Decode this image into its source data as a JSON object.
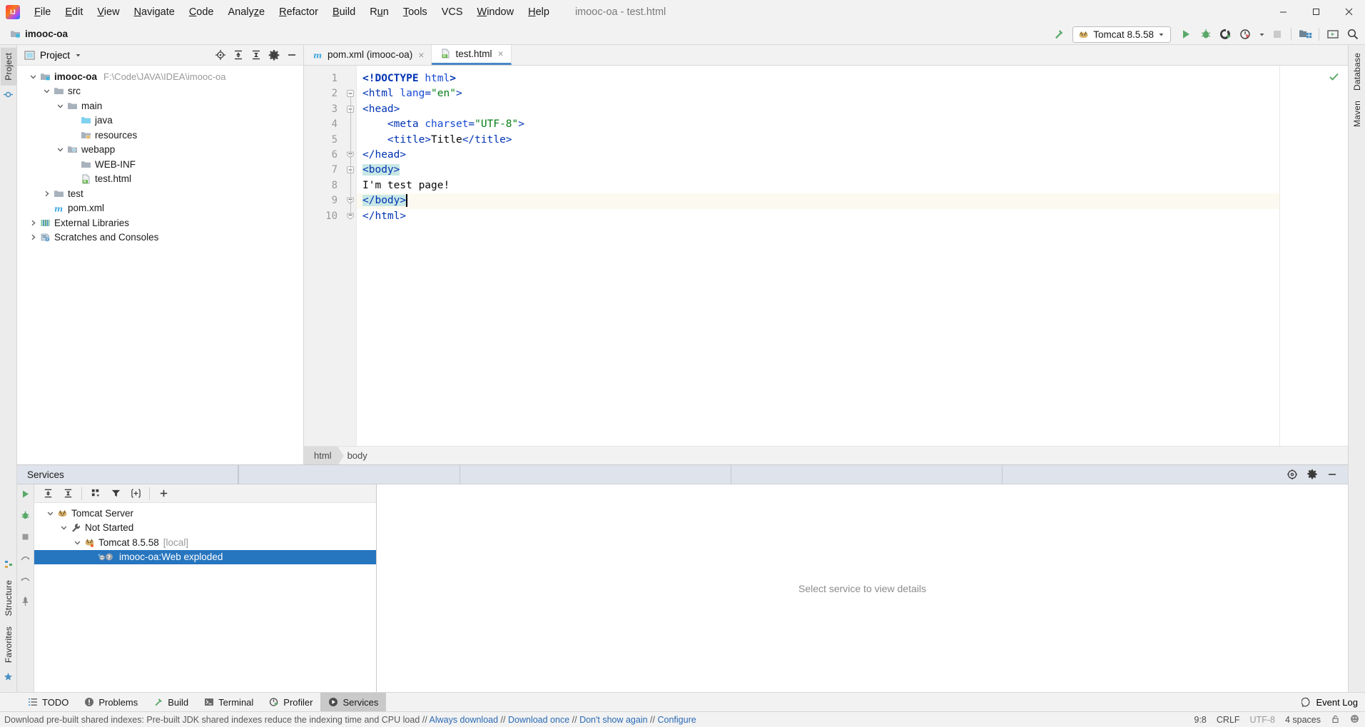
{
  "window": {
    "title": "imooc-oa - test.html",
    "project_name": "imooc-oa"
  },
  "menu": {
    "items": [
      {
        "pre": "",
        "mn": "F",
        "post": "ile"
      },
      {
        "pre": "",
        "mn": "E",
        "post": "dit"
      },
      {
        "pre": "",
        "mn": "V",
        "post": "iew"
      },
      {
        "pre": "",
        "mn": "N",
        "post": "avigate"
      },
      {
        "pre": "",
        "mn": "C",
        "post": "ode"
      },
      {
        "pre": "Analy",
        "mn": "z",
        "post": "e"
      },
      {
        "pre": "",
        "mn": "R",
        "post": "efactor"
      },
      {
        "pre": "",
        "mn": "B",
        "post": "uild"
      },
      {
        "pre": "R",
        "mn": "u",
        "post": "n"
      },
      {
        "pre": "",
        "mn": "T",
        "post": "ools"
      },
      {
        "pre": "VCS",
        "mn": "",
        "post": ""
      },
      {
        "pre": "",
        "mn": "W",
        "post": "indow"
      },
      {
        "pre": "",
        "mn": "H",
        "post": "elp"
      }
    ]
  },
  "toolbar": {
    "run_config": "Tomcat 8.5.58",
    "icons": [
      "build-hammer-icon",
      "run-icon",
      "debug-icon",
      "run-coverage-icon",
      "profiler-icon",
      "stop-icon",
      "project-structure-icon",
      "update-icon",
      "search-everywhere-icon"
    ]
  },
  "left_rail": {
    "top_tabs": [
      "Project"
    ],
    "bottom_tabs": [
      "Structure",
      "Favorites"
    ]
  },
  "right_rail": {
    "tabs": [
      "Database",
      "Maven"
    ]
  },
  "project_panel": {
    "title": "Project",
    "actions": [
      "locate-icon",
      "expand-all-icon",
      "collapse-all-icon",
      "settings-gear-icon",
      "hide-icon"
    ],
    "tree": [
      {
        "depth": 0,
        "arrow": "down",
        "icon": "module-folder-icon",
        "label": "imooc-oa",
        "bold": true,
        "path": "F:\\Code\\JAVA\\IDEA\\imooc-oa"
      },
      {
        "depth": 1,
        "arrow": "down",
        "icon": "folder-icon",
        "label": "src",
        "bold": false,
        "path": ""
      },
      {
        "depth": 2,
        "arrow": "down",
        "icon": "folder-icon",
        "label": "main",
        "bold": false,
        "path": ""
      },
      {
        "depth": 3,
        "arrow": "none",
        "icon": "source-folder-icon",
        "label": "java",
        "bold": false,
        "path": ""
      },
      {
        "depth": 3,
        "arrow": "none",
        "icon": "resources-folder-icon",
        "label": "resources",
        "bold": false,
        "path": ""
      },
      {
        "depth": 2,
        "arrow": "down",
        "icon": "webapp-folder-icon",
        "label": "webapp",
        "bold": false,
        "path": ""
      },
      {
        "depth": 3,
        "arrow": "none",
        "icon": "folder-icon",
        "label": "WEB-INF",
        "bold": false,
        "path": ""
      },
      {
        "depth": 3,
        "arrow": "none",
        "icon": "html-file-icon",
        "label": "test.html",
        "bold": false,
        "path": ""
      },
      {
        "depth": 1,
        "arrow": "right",
        "icon": "folder-icon",
        "label": "test",
        "bold": false,
        "path": ""
      },
      {
        "depth": 1,
        "arrow": "none",
        "icon": "maven-pom-icon",
        "label": "pom.xml",
        "bold": false,
        "path": ""
      },
      {
        "depth": 0,
        "arrow": "right",
        "icon": "library-icon",
        "label": "External Libraries",
        "bold": false,
        "path": ""
      },
      {
        "depth": 0,
        "arrow": "right",
        "icon": "scratches-icon",
        "label": "Scratches and Consoles",
        "bold": false,
        "path": ""
      }
    ]
  },
  "editor": {
    "tabs": [
      {
        "label": "pom.xml (imooc-oa)",
        "icon": "maven-pom-icon",
        "active": false
      },
      {
        "label": "test.html",
        "icon": "html-file-icon",
        "active": true
      }
    ],
    "line_numbers": [
      "1",
      "2",
      "3",
      "4",
      "5",
      "6",
      "7",
      "8",
      "9",
      "10"
    ],
    "caret_line": 9,
    "breadcrumbs": [
      {
        "label": "html",
        "selected": true
      },
      {
        "label": "body",
        "selected": false
      }
    ],
    "code_lines": [
      {
        "n": 1,
        "html": "<span class='tok-doctype'>&lt;!DOCTYPE</span> <span class='tok-dtval'>html</span><span class='tok-doctype'>&gt;</span>"
      },
      {
        "n": 2,
        "html": "<span class='tok-tag'>&lt;html</span> <span class='tok-attr'>lang</span><span class='tok-tag'>=</span><span class='tok-str'>\"en\"</span><span class='tok-tag'>&gt;</span>"
      },
      {
        "n": 3,
        "html": "<span class='tok-tag'>&lt;head&gt;</span>"
      },
      {
        "n": 4,
        "html": "    <span class='tok-tag'>&lt;meta</span> <span class='tok-attr'>charset</span><span class='tok-tag'>=</span><span class='tok-str'>\"UTF-8\"</span><span class='tok-tag'>&gt;</span>"
      },
      {
        "n": 5,
        "html": "    <span class='tok-tag'>&lt;title&gt;</span><span class='tok-txt'>Title</span><span class='tok-tag'>&lt;/title&gt;</span>"
      },
      {
        "n": 6,
        "html": "<span class='tok-tag'>&lt;/head&gt;</span>"
      },
      {
        "n": 7,
        "html": "<span class='tok-tag hl-brace'>&lt;body&gt;</span>"
      },
      {
        "n": 8,
        "html": "<span class='tok-txt'>I'm test page!</span>"
      },
      {
        "n": 9,
        "html": "<span class='tok-tag hl-brace'>&lt;/body&gt;</span>"
      },
      {
        "n": 10,
        "html": "<span class='tok-tag'>&lt;/html&gt;</span>"
      }
    ],
    "code_plain": [
      "<!DOCTYPE html>",
      "<html lang=\"en\">",
      "<head>",
      "    <meta charset=\"UTF-8\">",
      "    <title>Title</title>",
      "</head>",
      "<body>",
      "I'm test page!",
      "</body>",
      "</html>"
    ]
  },
  "services": {
    "header_title": "Services",
    "header_actions": [
      "settings-view-icon",
      "gear-icon",
      "hide-icon"
    ],
    "toolbar_icons": [
      "expand-all-icon",
      "collapse-all-icon",
      "group-icon",
      "filter-icon",
      "new-tab-icon",
      "add-icon"
    ],
    "rail_icons": [
      "run-icon",
      "debug-icon",
      "stop-icon",
      "step-over-icon",
      "step-back-icon",
      "pin-icon"
    ],
    "tree": [
      {
        "depth": 0,
        "arrow": "down",
        "icon": "tomcat-icon",
        "label": "Tomcat Server",
        "suffix": "",
        "selected": false
      },
      {
        "depth": 1,
        "arrow": "down",
        "icon": "wrench-icon",
        "label": "Not Started",
        "suffix": "",
        "selected": false
      },
      {
        "depth": 2,
        "arrow": "down",
        "icon": "tomcat-icon",
        "label": "Tomcat 8.5.58",
        "suffix": "[local]",
        "selected": false
      },
      {
        "depth": 3,
        "arrow": "none",
        "icon": "web-artifact-icon",
        "label": "imooc-oa:Web exploded",
        "suffix": "",
        "selected": true
      }
    ],
    "detail_placeholder": "Select service to view details"
  },
  "toolwindow_bar": {
    "items": [
      {
        "label": "TODO",
        "icon": "todo-icon",
        "active": false
      },
      {
        "label": "Problems",
        "icon": "problems-icon",
        "active": false
      },
      {
        "label": "Build",
        "icon": "build-icon",
        "active": false
      },
      {
        "label": "Terminal",
        "icon": "terminal-icon",
        "active": false
      },
      {
        "label": "Profiler",
        "icon": "profiler-icon",
        "active": false
      },
      {
        "label": "Services",
        "icon": "services-icon",
        "active": true
      }
    ],
    "event_log": "Event Log"
  },
  "statusbar": {
    "message_prefix": "Download pre-built shared indexes: Pre-built JDK shared indexes reduce the indexing time and CPU load // ",
    "link1": "Always download",
    "sep1": " // ",
    "link2": "Download once",
    "sep2": " // ",
    "link3": "Don't show again",
    "sep3": " // ",
    "link4": "Configure",
    "caret_position": "9:8",
    "line_separator": "CRLF",
    "encoding": "UTF-8",
    "indent": "4 spaces",
    "lock_icon": "lock-icon",
    "inspection_icon": "inspection-icon"
  },
  "colors": {
    "accent_blue": "#2675bf",
    "tab_underline": "#4a86c8",
    "services_header": "#dfe3eb",
    "run_green": "#59a869",
    "chrome_bg": "#f2f2f2",
    "editor_bg": "#ffffff",
    "caret_line": "#fcfaf0",
    "brace_highlight": "#c8e8e5"
  }
}
